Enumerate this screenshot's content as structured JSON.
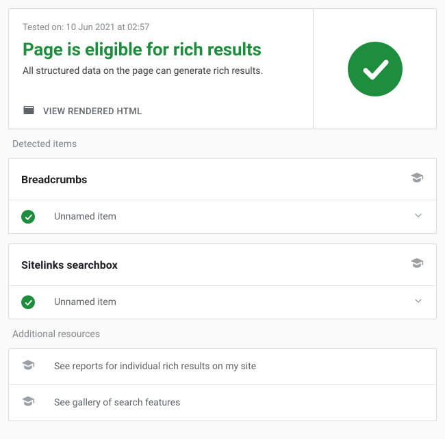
{
  "status": {
    "tested_on": "Tested on: 10 Jun 2021 at 02:57",
    "headline": "Page is eligible for rich results",
    "subtext": "All structured data on the page can generate rich results.",
    "view_rendered": "VIEW RENDERED HTML"
  },
  "detected": {
    "title": "Detected items",
    "groups": [
      {
        "title": "Breadcrumbs",
        "item_label": "Unnamed item"
      },
      {
        "title": "Sitelinks searchbox",
        "item_label": "Unnamed item"
      }
    ]
  },
  "resources": {
    "title": "Additional resources",
    "items": [
      {
        "label": "See reports for individual rich results on my site"
      },
      {
        "label": "See gallery of search features"
      }
    ]
  }
}
